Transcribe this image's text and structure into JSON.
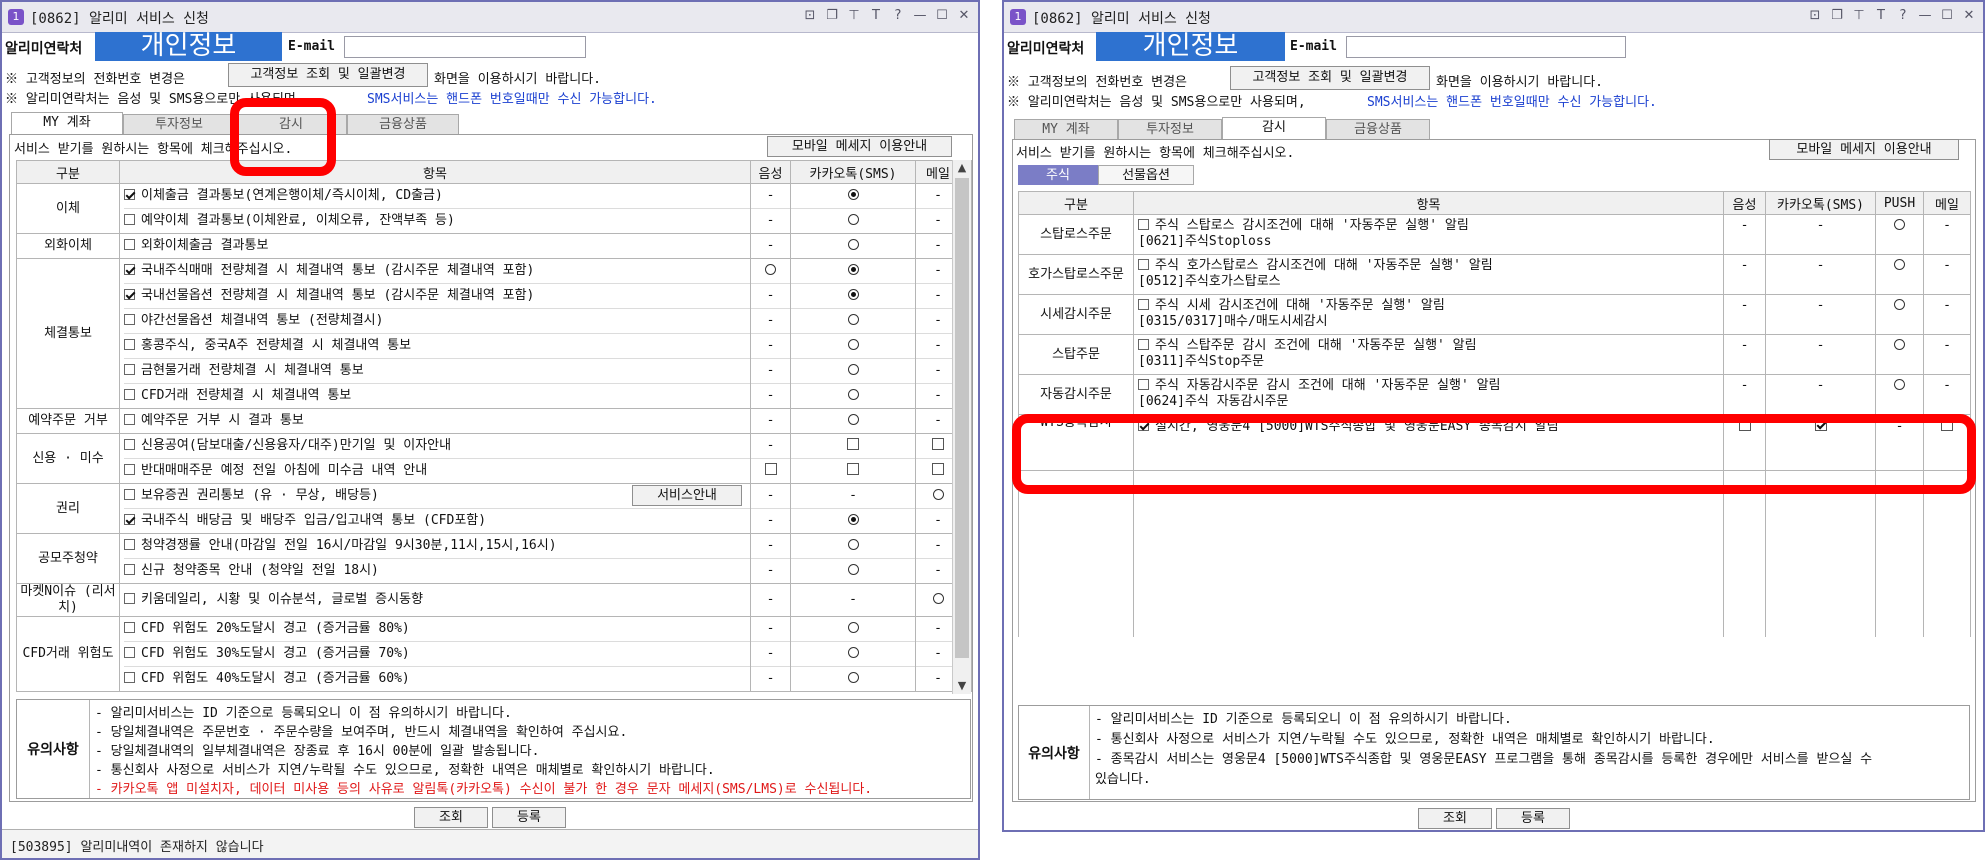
{
  "window_title": "[0862] 알리미 서비스 신청",
  "app_icon_text": "1",
  "title_buttons": [
    "⊡",
    "❐",
    "⊤",
    "T",
    "?",
    "—",
    "☐",
    "✕"
  ],
  "common": {
    "contact_label": "알리미연락처",
    "overlay_text": "개인정보",
    "email_label": "E-mail",
    "note1_prefix": "※ 고객정보의 전화번호 변경은",
    "customer_info_button": "고객정보 조회 및 일괄변경",
    "note1_suffix": "화면을 이용하시기 바랍니다.",
    "note2": "※ 알리미연락처는 음성 및 SMS용으로만 사용되며,",
    "note2_blue": "SMS서비스는 핸드폰 번호일때만 수신 가능합니다.",
    "tabs": [
      "MY 계좌",
      "투자정보",
      "감시",
      "금융상품"
    ],
    "instruction": "서비스 받기를 원하시는 항목에 체크해주십시오.",
    "mobile_button": "모바일 메세지 이용안내",
    "notice_label": "유의사항",
    "lookup_button": "조회",
    "register_button": "등록"
  },
  "left": {
    "active_tab": "MY 계좌",
    "columns": [
      "구분",
      "항목",
      "음성",
      "카카오톡(SMS)",
      "메일"
    ],
    "groups": [
      {
        "category": "이체",
        "rows": [
          {
            "checked": true,
            "text": "이체출금 결과통보(연계은행이체/즉시이체, CD출금)",
            "voice": "-",
            "kakao": "radio-on",
            "mail": "-"
          },
          {
            "checked": false,
            "text": "예약이체 결과통보(이체완료, 이체오류, 잔액부족 등)",
            "voice": "-",
            "kakao": "radio",
            "mail": "-"
          }
        ]
      },
      {
        "category": "외화이체",
        "rows": [
          {
            "checked": false,
            "text": "외화이체출금 결과통보",
            "voice": "-",
            "kakao": "radio",
            "mail": "-"
          }
        ]
      },
      {
        "category": "체결통보",
        "rows": [
          {
            "checked": true,
            "text": "국내주식매매 전량체결 시 체결내역 통보 (감시주문 체결내역 포함)",
            "voice": "radio",
            "kakao": "radio-on",
            "mail": "-"
          },
          {
            "checked": true,
            "text": "국내선물옵션 전량체결 시 체결내역 통보 (감시주문 체결내역 포함)",
            "voice": "-",
            "kakao": "radio-on",
            "mail": "-"
          },
          {
            "checked": false,
            "text": "야간선물옵션 체결내역 통보 (전량체결시)",
            "voice": "-",
            "kakao": "radio",
            "mail": "-"
          },
          {
            "checked": false,
            "text": "홍콩주식, 중국A주 전량체결 시 체결내역 통보",
            "voice": "-",
            "kakao": "radio",
            "mail": "-"
          },
          {
            "checked": false,
            "text": "금현물거래 전량체결 시 체결내역 통보",
            "voice": "-",
            "kakao": "radio",
            "mail": "-"
          },
          {
            "checked": false,
            "text": "CFD거래 전량체결 시 체결내역 통보",
            "voice": "-",
            "kakao": "radio",
            "mail": "-"
          }
        ]
      },
      {
        "category": "예약주문 거부",
        "rows": [
          {
            "checked": false,
            "text": "예약주문 거부 시 결과 통보",
            "voice": "-",
            "kakao": "radio",
            "mail": "-"
          }
        ]
      },
      {
        "category": "신용 · 미수",
        "rows": [
          {
            "checked": false,
            "text": "신용공여(담보대출/신용융자/대주)만기일 및 이자안내",
            "voice": "-",
            "kakao": "box",
            "mail": "box"
          },
          {
            "checked": false,
            "text": "반대매매주문 예정 전일 아침에 미수금 내역 안내",
            "voice": "box",
            "kakao": "box",
            "mail": "box"
          }
        ]
      },
      {
        "category": "권리",
        "rows": [
          {
            "checked": false,
            "text": "보유증권 권리통보 (유 · 무상, 배당등)",
            "voice": "-",
            "kakao": "-",
            "mail": "radio",
            "button": "서비스안내"
          },
          {
            "checked": true,
            "text": "국내주식 배당금 및 배당주 입금/입고내역 통보 (CFD포함)",
            "voice": "-",
            "kakao": "radio-on",
            "mail": "-"
          }
        ]
      },
      {
        "category": "공모주청약",
        "rows": [
          {
            "checked": false,
            "text": "청약경쟁률 안내(마감일 전일 16시/마감일 9시30분,11시,15시,16시)",
            "voice": "-",
            "kakao": "radio",
            "mail": "-"
          },
          {
            "checked": false,
            "text": "신규 청약종목 안내 (청약일 전일 18시)",
            "voice": "-",
            "kakao": "radio",
            "mail": "-"
          }
        ]
      },
      {
        "category": "마켓N이슈 (리서치)",
        "rows": [
          {
            "checked": false,
            "text": "키움데일리, 시황 및 이슈분석, 글로벌 증시동향",
            "voice": "-",
            "kakao": "-",
            "mail": "radio"
          }
        ]
      },
      {
        "category": "CFD거래 위험도",
        "rows": [
          {
            "checked": false,
            "text": "CFD 위험도 20%도달시 경고 (증거금률 80%)",
            "voice": "-",
            "kakao": "radio",
            "mail": "-"
          },
          {
            "checked": false,
            "text": "CFD 위험도 30%도달시 경고 (증거금률 70%)",
            "voice": "-",
            "kakao": "radio",
            "mail": "-"
          },
          {
            "checked": false,
            "text": "CFD 위험도 40%도달시 경고 (증거금률 60%)",
            "voice": "-",
            "kakao": "radio",
            "mail": "-"
          }
        ]
      }
    ],
    "notice_lines": [
      {
        "text": "- 알리미서비스는 ID 기준으로 등록되오니 이 점 유의하시기 바랍니다.",
        "red": false
      },
      {
        "text": "- 당일체결내역은 주문번호 · 주문수량을 보여주며, 반드시 체결내역을 확인하여 주십시요.",
        "red": false
      },
      {
        "text": "- 당일체결내역의 일부체결내역은 장종료 후 16시 00분에 일괄 발송됩니다.",
        "red": false
      },
      {
        "text": "- 통신회사 사정으로 서비스가 지연/누락될 수도 있으므로, 정확한 내역은 매체별로 확인하시기 바랍니다.",
        "red": false
      },
      {
        "text": "- 카카오톡 앱 미설치자, 데이터 미사용 등의 사유로 알림톡(카카오톡) 수신이 불가 한 경우 문자 메세지(SMS/LMS)로 수신됩니다.",
        "red": true
      }
    ],
    "status": "[503895] 알리미내역이 존재하지 않습니다"
  },
  "right": {
    "active_tab": "감시",
    "subtabs": [
      "주식",
      "선물옵션"
    ],
    "columns": [
      "구분",
      "항목",
      "음성",
      "카카오톡(SMS)",
      "PUSH",
      "메일"
    ],
    "rows": [
      {
        "category": "스탑로스주문",
        "line1": "주식 스탑로스 감시조건에 대해 '자동주문 실행' 알림",
        "line2": "[0621]주식Stoploss",
        "checked": false,
        "voice": "-",
        "kakao": "-",
        "push": "radio",
        "mail": "-"
      },
      {
        "category": "호가스탑로스주문",
        "line1": "주식 호가스탑로스 감시조건에 대해 '자동주문 실행' 알림",
        "line2": "[0512]주식호가스탑로스",
        "checked": false,
        "voice": "-",
        "kakao": "-",
        "push": "radio",
        "mail": "-"
      },
      {
        "category": "시세감시주문",
        "line1": "주식 시세 감시조건에 대해 '자동주문 실행' 알림",
        "line2": "[0315/0317]매수/매도시세감시",
        "checked": false,
        "voice": "-",
        "kakao": "-",
        "push": "radio",
        "mail": "-"
      },
      {
        "category": "스탑주문",
        "line1": "주식 스탑주문 감시 조건에 대해 '자동주문 실행' 알림",
        "line2": "[0311]주식Stop주문",
        "checked": false,
        "voice": "-",
        "kakao": "-",
        "push": "radio",
        "mail": "-"
      },
      {
        "category": "자동감시주문",
        "line1": "주식 자동감시주문 감시 조건에 대해 '자동주문 실행' 알림",
        "line2": "[0624]주식 자동감시주문",
        "checked": false,
        "voice": "-",
        "kakao": "-",
        "push": "radio",
        "mail": "-"
      },
      {
        "category": "WTS종목감시",
        "line1": "실시간, 영웅문4 [5000]WTS주식종합 및 영웅문EASY 종목감시 알림",
        "line2": "",
        "checked": true,
        "voice": "box",
        "kakao": "box-on",
        "push": "-",
        "mail": "box"
      }
    ],
    "notice_lines": [
      "- 알리미서비스는 ID 기준으로 등록되오니 이 점 유의하시기 바랍니다.",
      "- 통신회사 사정으로 서비스가 지연/누락될 수도 있으므로, 정확한 내역은 매체별로 확인하시기 바랍니다.",
      "- 종목감시 서비스는 영웅문4 [5000]WTS주식종합 및 영웅문EASY 프로그램을 통해 종목감시를 등록한 경우에만 서비스를 받으실 수",
      "  있습니다."
    ]
  }
}
